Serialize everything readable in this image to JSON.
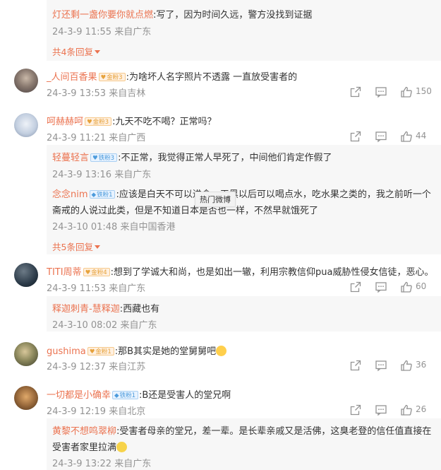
{
  "thread0": {
    "sub": {
      "user": "灯还剩一盏你要你就点燃",
      "text": ":写了，因为时间久远，警方没找到证据",
      "meta": "24-3-9 11:55 来自广东"
    },
    "more": "共4条回复"
  },
  "c1": {
    "user": "_人间百香果",
    "badge": "金粉3",
    "text": ":为啥坏人名字照片不透露 一直放受害者的",
    "meta": "24-3-9 13:53 来自吉林",
    "likes": "150"
  },
  "c2": {
    "user": "呵赫赫呵",
    "badge": "金粉3",
    "text": ":九天不吃不喝？正常吗？",
    "meta": "24-3-9 11:21 来自广西",
    "likes": "44",
    "sub1": {
      "user": "轻蔓轻言",
      "badge": "铁粉3",
      "text": ":不正常，我觉得正常人早死了，中间他们肯定作假了",
      "meta": "24-3-9 13:16 来自广东"
    },
    "sub2": {
      "user": "念念nim",
      "badge": "铁粉1",
      "text_l1": ":应该是白天不可以进食，天黑以后可以喝点水，吃水果之类的，我之前听一个",
      "text_l2": "斋戒的人说过此类，但是不知道日本是否也一样，不然早就饿死了",
      "meta": "24-3-10 01:48 来自中国香港"
    },
    "more": "共5条回复"
  },
  "tooltip": "热门微博",
  "c3": {
    "user": "TITI周蒂",
    "badge": "金粉4",
    "text": ":想到了学诚大和尚，也是如出一辙，利用宗教信仰pua威胁性侵女信徒，恶心。",
    "meta": "24-3-9 11:53 来自广东",
    "likes": "60",
    "sub1": {
      "user": "释迦刺青-慧释迦",
      "text": ":西藏也有",
      "meta": "24-3-10 08:02 来自广东"
    }
  },
  "c4": {
    "user": "gushima",
    "badge": "金粉1",
    "text": ":那B其实是她的堂舅舅吧",
    "meta": "24-3-9 12:37 来自江苏",
    "likes": "36"
  },
  "c5": {
    "user": "一切都是小确幸",
    "badge": "铁粉1",
    "text": ":B还是受害人的堂兄啊",
    "meta": "24-3-9 12:19 来自北京",
    "likes": "26",
    "sub1": {
      "user": "黄黎不想鸣翠柳",
      "text_l1": ":受害者母亲的堂兄，差一辈。是长辈亲戚又是活佛，这臭老登的信任值直接在",
      "text_l2": "受害者家里拉满",
      "meta": "24-3-9 13:22 来自广东"
    }
  },
  "colors": {
    "username": "#eb7350",
    "meta": "#939393",
    "text": "#333333",
    "reply_bg": "#f7f7f7"
  },
  "icons": [
    "share-icon",
    "comment-icon",
    "like-icon",
    "caret-down-icon",
    "smiley-emoji"
  ]
}
